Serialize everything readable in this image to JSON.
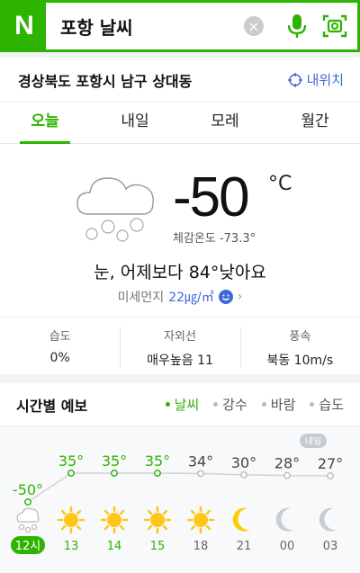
{
  "search": {
    "logo": "N",
    "query": "포항 날씨",
    "clear_icon": "×"
  },
  "location": {
    "name": "경상북도 포항시 남구 상대동",
    "my_location_label": "내위치"
  },
  "tabs": [
    {
      "label": "오늘",
      "active": true
    },
    {
      "label": "내일",
      "active": false
    },
    {
      "label": "모레",
      "active": false
    },
    {
      "label": "월간",
      "active": false
    }
  ],
  "current": {
    "temperature": "-50",
    "unit": "°C",
    "feels_like": "체감온도 -73.3°",
    "comparison": "눈, 어제보다 84°낮아요",
    "fine_dust_label": "미세먼지",
    "fine_dust_value": "22㎍/㎥",
    "condition_icon": "snow-cloud-icon"
  },
  "stats": [
    {
      "label": "습도",
      "value": "0%"
    },
    {
      "label": "자외선",
      "value": "매우높음 11"
    },
    {
      "label": "풍속",
      "value": "북동 10m/s"
    }
  ],
  "hourly": {
    "title": "시간별 예보",
    "filters": [
      {
        "label": "날씨",
        "active": true
      },
      {
        "label": "강수",
        "active": false
      },
      {
        "label": "바람",
        "active": false
      },
      {
        "label": "습도",
        "active": false
      }
    ],
    "tomorrow_badge": "내일",
    "items": [
      {
        "temp_label": "-50°",
        "temp": -50,
        "hour": "12시",
        "icon": "snow-cloud-icon",
        "current": true
      },
      {
        "temp_label": "35°",
        "temp": 35,
        "hour": "13",
        "icon": "sun-icon",
        "highlight": true
      },
      {
        "temp_label": "35°",
        "temp": 35,
        "hour": "14",
        "icon": "sun-icon",
        "highlight": true
      },
      {
        "temp_label": "35°",
        "temp": 35,
        "hour": "15",
        "icon": "sun-icon",
        "highlight": true
      },
      {
        "temp_label": "34°",
        "temp": 34,
        "hour": "18",
        "icon": "sun-icon"
      },
      {
        "temp_label": "30°",
        "temp": 30,
        "hour": "21",
        "icon": "moon-icon"
      },
      {
        "temp_label": "28°",
        "temp": 28,
        "hour": "00",
        "icon": "moon-gray-icon"
      },
      {
        "temp_label": "27°",
        "temp": 27,
        "hour": "03",
        "icon": "moon-gray-icon"
      }
    ]
  },
  "colors": {
    "naver_green": "#2db400",
    "link_blue": "#3d6ad6",
    "sun_yellow": "#ffcc33"
  }
}
